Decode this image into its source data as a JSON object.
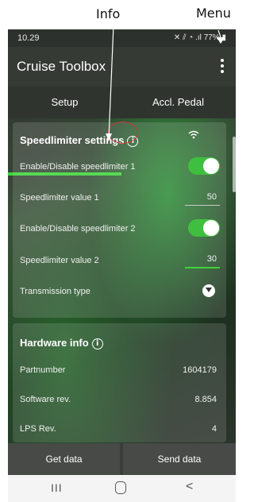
{
  "annotations": {
    "info_label": "Info",
    "menu_label": "Menu"
  },
  "status_bar": {
    "time": "10.29",
    "icons_text": "77%"
  },
  "app": {
    "title": "Cruise Toolbox"
  },
  "tabs": [
    {
      "label": "Setup",
      "selected": true
    },
    {
      "label": "Accl. Pedal",
      "selected": false
    }
  ],
  "speedlimiter": {
    "title": "Speedlimiter settings",
    "rows": [
      {
        "label": "Enable/Disable speedlimiter 1",
        "type": "toggle",
        "on": true
      },
      {
        "label": "Speedlimiter value 1",
        "type": "value",
        "value": "50"
      },
      {
        "label": "Enable/Disable speedlimiter 2",
        "type": "toggle",
        "on": true
      },
      {
        "label": "Speedlimiter value 2",
        "type": "value",
        "value": "30"
      },
      {
        "label": "Transmission type",
        "type": "dropdown"
      }
    ]
  },
  "hardware": {
    "title": "Hardware info",
    "rows": [
      {
        "label": "Partnumber",
        "value": "1604179"
      },
      {
        "label": "Software rev.",
        "value": "8.854"
      },
      {
        "label": "LPS Rev.",
        "value": "4"
      }
    ]
  },
  "buttons": {
    "get": "Get data",
    "send": "Send data"
  },
  "nav": {
    "recent": "III",
    "back": "<"
  },
  "colors": {
    "accent": "#3fd43a",
    "toggle_on": "#3fbf3f",
    "annotation_ring": "#d13535"
  }
}
